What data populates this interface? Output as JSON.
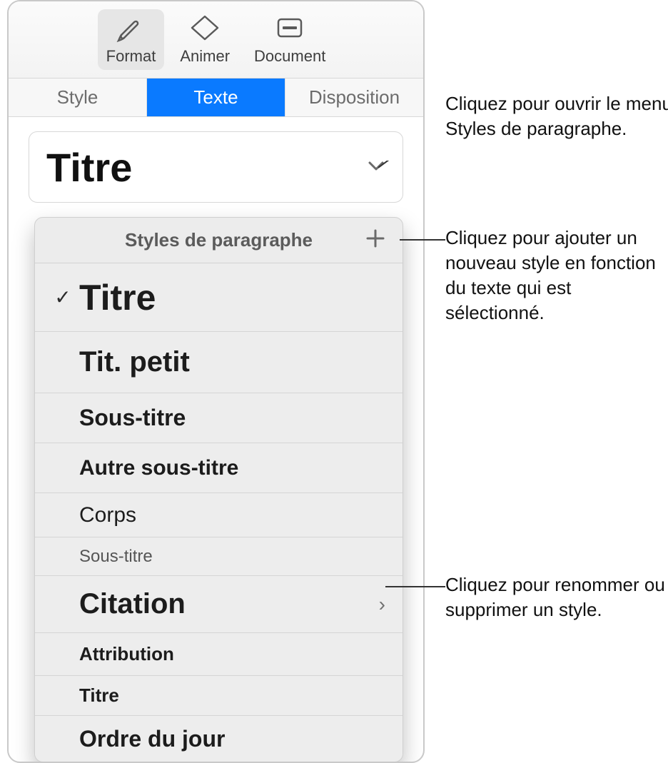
{
  "toolbar": {
    "format": "Format",
    "animer": "Animer",
    "document": "Document"
  },
  "tabs": {
    "style": "Style",
    "texte": "Texte",
    "disposition": "Disposition"
  },
  "style_selector": {
    "current": "Titre"
  },
  "popover": {
    "title": "Styles de paragraphe",
    "items": [
      {
        "label": "Titre",
        "checked": true,
        "arrow": false,
        "cls": "h-titre"
      },
      {
        "label": "Tit. petit",
        "checked": false,
        "arrow": false,
        "cls": "h-titpetit"
      },
      {
        "label": "Sous-titre",
        "checked": false,
        "arrow": false,
        "cls": "h-soust"
      },
      {
        "label": "Autre sous-titre",
        "checked": false,
        "arrow": false,
        "cls": "h-autre"
      },
      {
        "label": "Corps",
        "checked": false,
        "arrow": false,
        "cls": "h-corps"
      },
      {
        "label": "Sous-titre",
        "checked": false,
        "arrow": false,
        "cls": "h-soust2"
      },
      {
        "label": "Citation",
        "checked": false,
        "arrow": true,
        "cls": "h-citation"
      },
      {
        "label": "Attribution",
        "checked": false,
        "arrow": false,
        "cls": "h-attrib"
      },
      {
        "label": "Titre",
        "checked": false,
        "arrow": false,
        "cls": "h-titre2"
      },
      {
        "label": "Ordre du jour",
        "checked": false,
        "arrow": false,
        "cls": "h-ordre"
      }
    ]
  },
  "callouts": {
    "open_menu": "Cliquez pour ouvrir le menu Styles de paragraphe.",
    "add_style": "Cliquez pour ajouter un nouveau style en fonction du texte qui est sélectionné.",
    "rename": "Cliquez pour renommer ou supprimer un style."
  }
}
